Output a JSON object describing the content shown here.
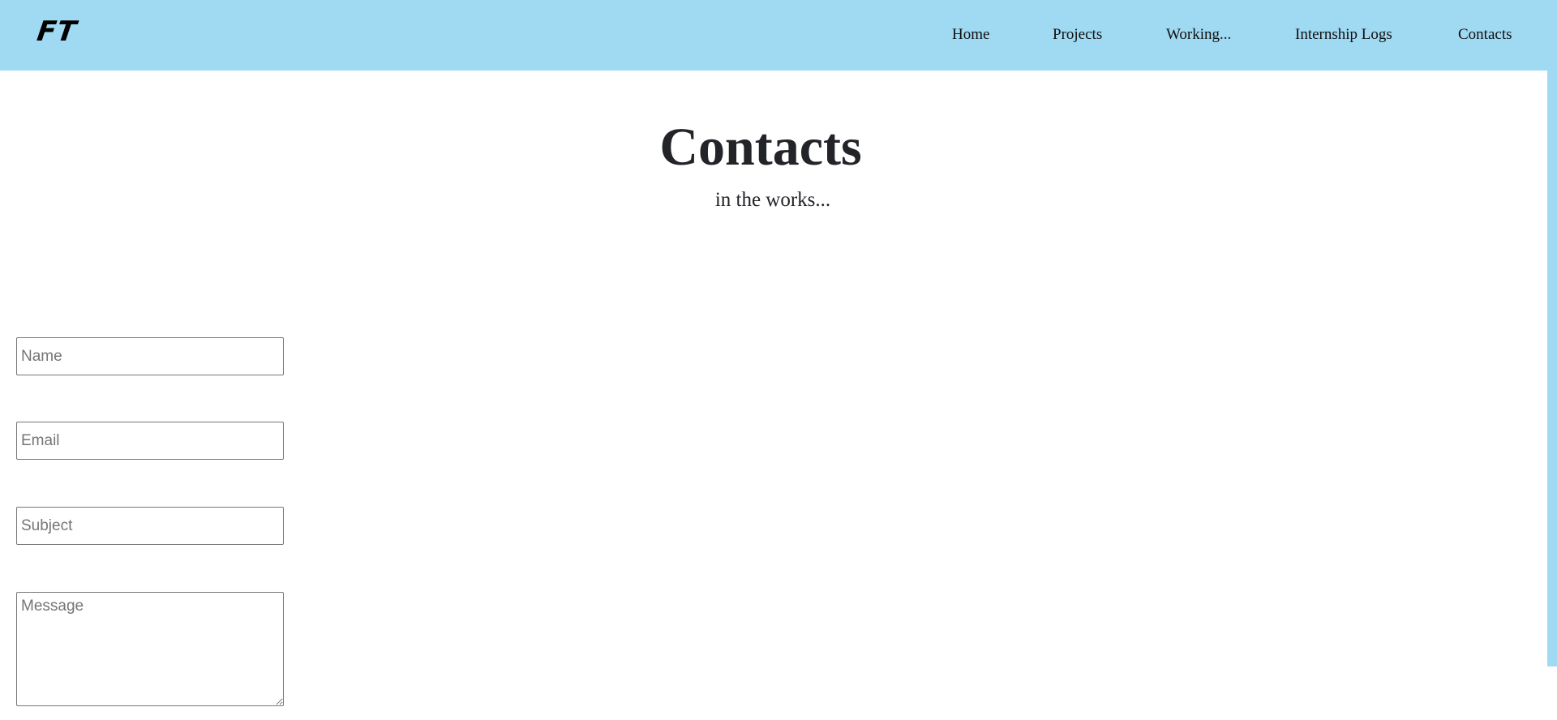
{
  "header": {
    "logo_text": "FT",
    "nav": [
      {
        "label": "Home"
      },
      {
        "label": "Projects"
      },
      {
        "label": "Working..."
      },
      {
        "label": "Internship Logs"
      },
      {
        "label": "Contacts"
      }
    ]
  },
  "colors": {
    "navbar_bg": "#9fd9f2",
    "page_bg": "#ffffff",
    "heading_text": "#222428"
  },
  "main": {
    "title": "Contacts",
    "subtitle": "in the works..."
  },
  "form": {
    "name_placeholder": "Name",
    "email_placeholder": "Email",
    "subject_placeholder": "Subject",
    "message_placeholder": "Message"
  }
}
